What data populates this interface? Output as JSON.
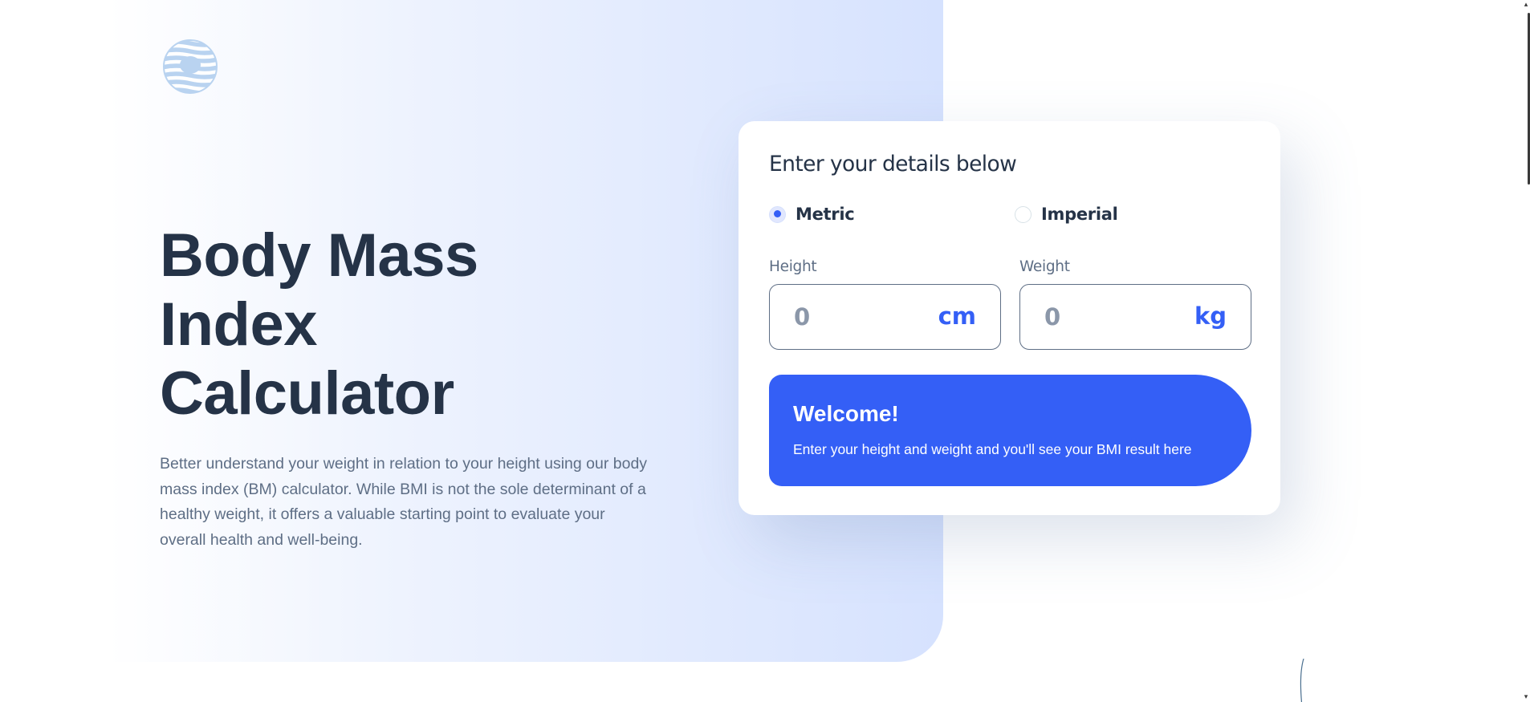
{
  "hero": {
    "title_line1": "Body Mass",
    "title_line2": "Index",
    "title_line3": "Calculator",
    "description": "Better understand your weight in relation to your height using our body mass index (BM) calculator. While BMI is not the sole determinant of a healthy weight, it offers a valuable starting point to evaluate your overall health and well-being."
  },
  "logo": {
    "icon": "logo-icon"
  },
  "form": {
    "title": "Enter your details below",
    "units": [
      {
        "label": "Metric",
        "checked": true
      },
      {
        "label": "Imperial",
        "checked": false
      }
    ],
    "height": {
      "label": "Height",
      "placeholder": "0",
      "unit": "cm"
    },
    "weight": {
      "label": "Weight",
      "placeholder": "0",
      "unit": "kg"
    }
  },
  "result": {
    "title": "Welcome!",
    "text": "Enter your height and weight and you'll see your BMI result here"
  },
  "colors": {
    "accent": "#345ff6",
    "heading": "#253347",
    "body_text": "#5e6e85",
    "hero_gradient_end": "#d6e2fe"
  }
}
